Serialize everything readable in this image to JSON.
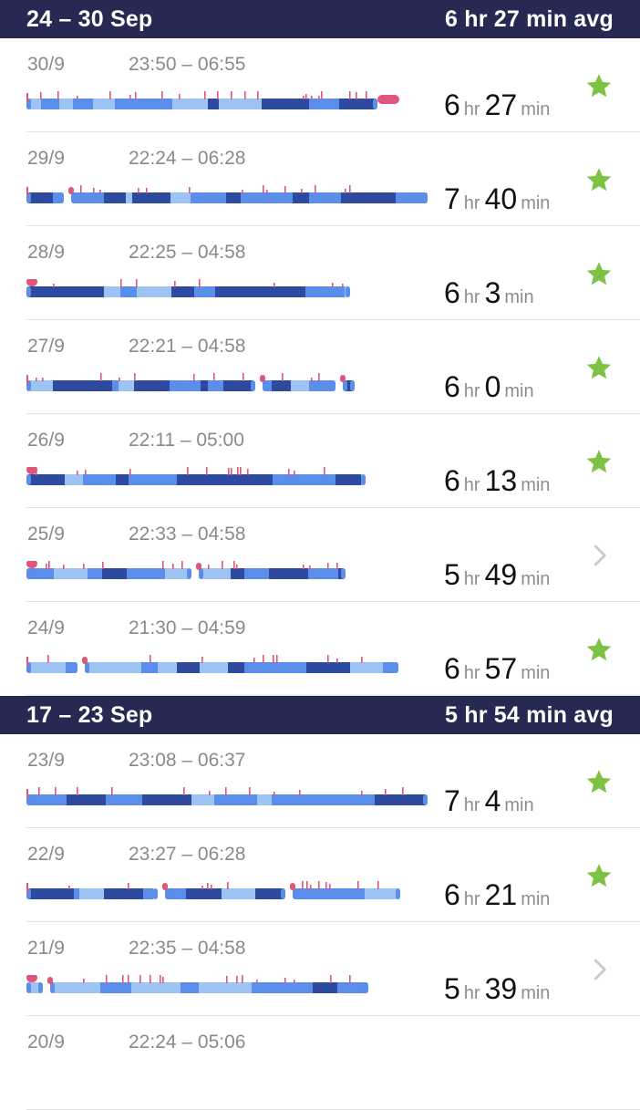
{
  "colors": {
    "header_bg": "#262a52",
    "deep": "#2e4a9e",
    "core": "#5b8dea",
    "light": "#9cc3f1",
    "awake": "#e0557a",
    "star": "#7dc243",
    "chevron": "#c9c9c9"
  },
  "weeks": [
    {
      "range": "24 – 30 Sep",
      "avg": "6 hr 27 min avg",
      "nights": [
        {
          "date": "30/9",
          "times": "23:50 – 06:55",
          "hours": "6",
          "minutes": "27",
          "hr_label": "hr",
          "min_label": "min",
          "icon": "star-icon",
          "seed": 3
        },
        {
          "date": "29/9",
          "times": "22:24 – 06:28",
          "hours": "7",
          "minutes": "40",
          "hr_label": "hr",
          "min_label": "min",
          "icon": "star-icon",
          "seed": 7
        },
        {
          "date": "28/9",
          "times": "22:25 – 04:58",
          "hours": "6",
          "minutes": "3",
          "hr_label": "hr",
          "min_label": "min",
          "icon": "star-icon",
          "seed": 11
        },
        {
          "date": "27/9",
          "times": "22:21 – 04:58",
          "hours": "6",
          "minutes": "0",
          "hr_label": "hr",
          "min_label": "min",
          "icon": "star-icon",
          "seed": 13
        },
        {
          "date": "26/9",
          "times": "22:11 – 05:00",
          "hours": "6",
          "minutes": "13",
          "hr_label": "hr",
          "min_label": "min",
          "icon": "star-icon",
          "seed": 17
        },
        {
          "date": "25/9",
          "times": "22:33 – 04:58",
          "hours": "5",
          "minutes": "49",
          "hr_label": "hr",
          "min_label": "min",
          "icon": "chevron-right-icon",
          "seed": 19
        },
        {
          "date": "24/9",
          "times": "21:30 – 04:59",
          "hours": "6",
          "minutes": "57",
          "hr_label": "hr",
          "min_label": "min",
          "icon": "star-icon",
          "seed": 23
        }
      ]
    },
    {
      "range": "17 – 23 Sep",
      "avg": "5 hr 54 min avg",
      "nights": [
        {
          "date": "23/9",
          "times": "23:08 – 06:37",
          "hours": "7",
          "minutes": "4",
          "hr_label": "hr",
          "min_label": "min",
          "icon": "star-icon",
          "seed": 29
        },
        {
          "date": "22/9",
          "times": "23:27 – 06:28",
          "hours": "6",
          "minutes": "21",
          "hr_label": "hr",
          "min_label": "min",
          "icon": "star-icon",
          "seed": 31
        },
        {
          "date": "21/9",
          "times": "22:35 – 04:58",
          "hours": "5",
          "minutes": "39",
          "hr_label": "hr",
          "min_label": "min",
          "icon": "chevron-right-icon",
          "seed": 37
        },
        {
          "date": "20/9",
          "times": "22:24 – 05:06",
          "hours": "",
          "minutes": "",
          "hr_label": "",
          "min_label": "",
          "icon": "",
          "seed": 41
        }
      ]
    }
  ]
}
